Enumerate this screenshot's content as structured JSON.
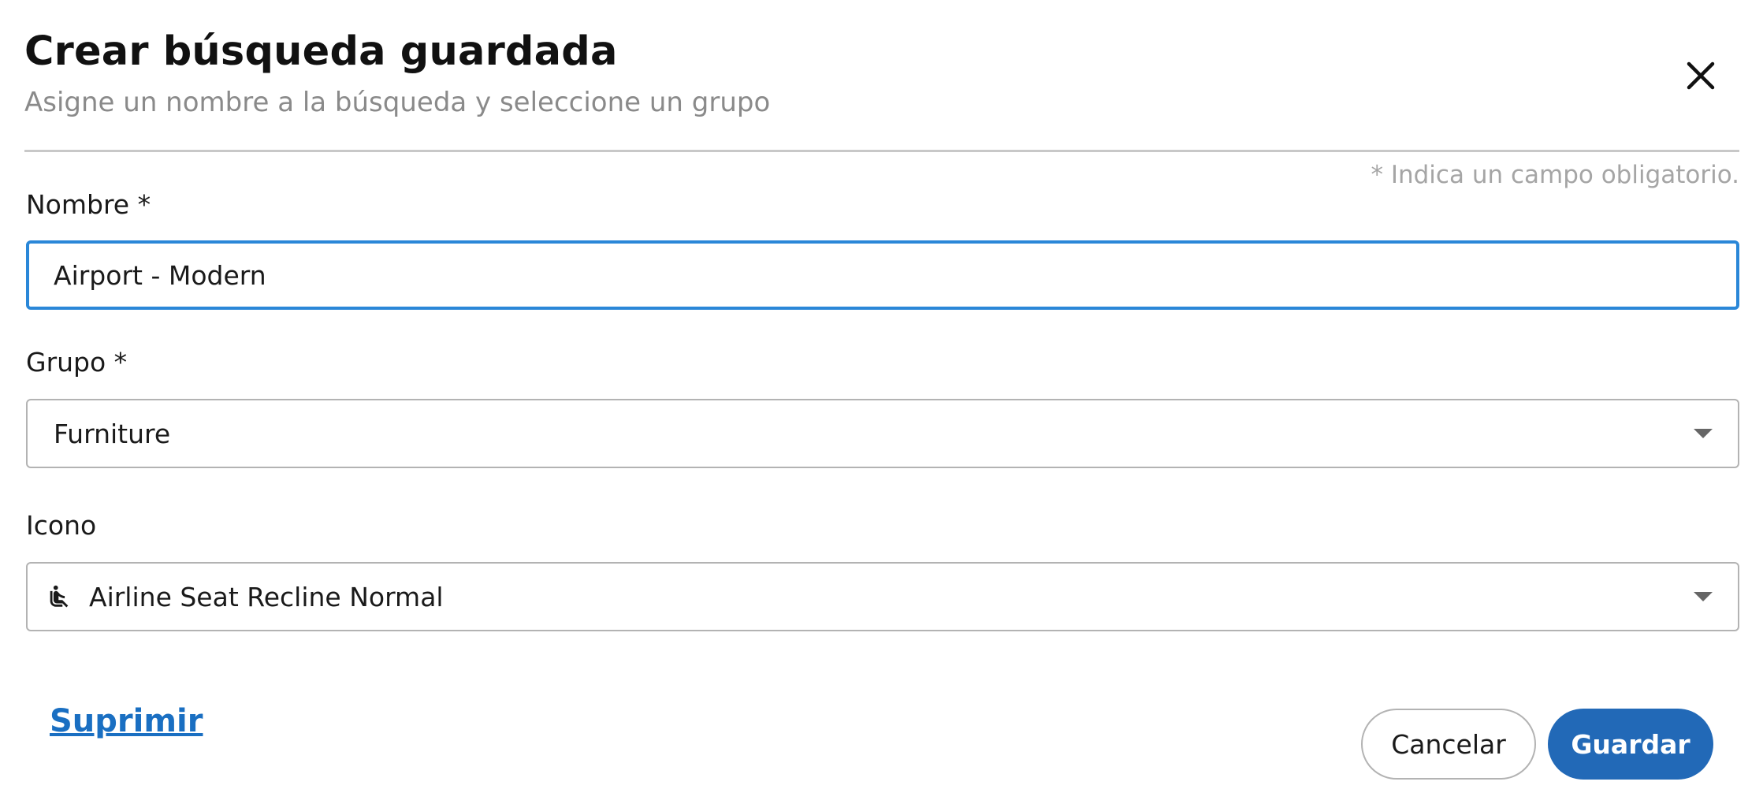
{
  "dialog": {
    "title": "Crear búsqueda guardada",
    "subtitle": "Asigne un nombre a la búsqueda y seleccione un grupo",
    "close_icon": "close-icon",
    "required_note": "* Indica un campo obligatorio."
  },
  "form": {
    "name": {
      "label": "Nombre *",
      "value": "Airport - Modern"
    },
    "group": {
      "label": "Grupo *",
      "selected": "Furniture",
      "caret_icon": "caret-down-icon"
    },
    "icon": {
      "label": "Icono",
      "selected": "Airline Seat Recline Normal",
      "selected_icon": "airline-seat-recline-normal-icon",
      "caret_icon": "caret-down-icon"
    }
  },
  "actions": {
    "delete_label": "Suprimir",
    "cancel_label": "Cancelar",
    "save_label": "Guardar"
  },
  "colors": {
    "accent": "#2269b7",
    "focus_border": "#2a87d8",
    "link": "#1a6fc2",
    "muted_text": "#8a8a8a"
  }
}
